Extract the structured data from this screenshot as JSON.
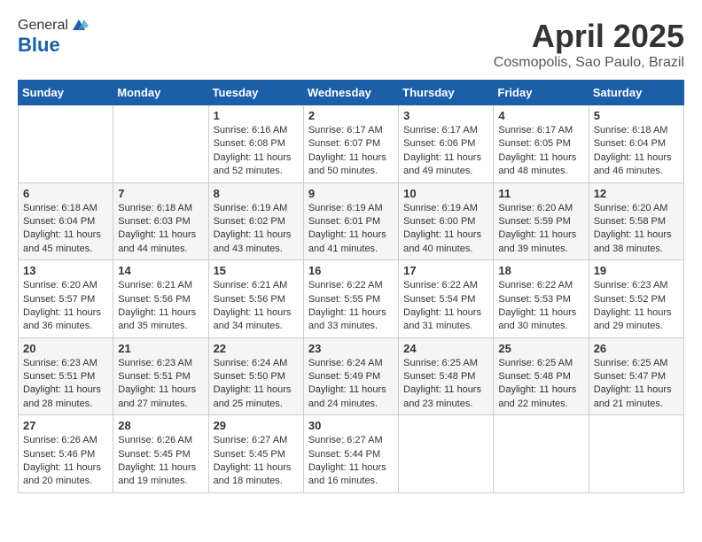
{
  "header": {
    "logo_general": "General",
    "logo_blue": "Blue",
    "month_title": "April 2025",
    "location": "Cosmopolis, Sao Paulo, Brazil"
  },
  "weekdays": [
    "Sunday",
    "Monday",
    "Tuesday",
    "Wednesday",
    "Thursday",
    "Friday",
    "Saturday"
  ],
  "weeks": [
    [
      {
        "day": "",
        "content": ""
      },
      {
        "day": "",
        "content": ""
      },
      {
        "day": "1",
        "content": "Sunrise: 6:16 AM\nSunset: 6:08 PM\nDaylight: 11 hours and 52 minutes."
      },
      {
        "day": "2",
        "content": "Sunrise: 6:17 AM\nSunset: 6:07 PM\nDaylight: 11 hours and 50 minutes."
      },
      {
        "day": "3",
        "content": "Sunrise: 6:17 AM\nSunset: 6:06 PM\nDaylight: 11 hours and 49 minutes."
      },
      {
        "day": "4",
        "content": "Sunrise: 6:17 AM\nSunset: 6:05 PM\nDaylight: 11 hours and 48 minutes."
      },
      {
        "day": "5",
        "content": "Sunrise: 6:18 AM\nSunset: 6:04 PM\nDaylight: 11 hours and 46 minutes."
      }
    ],
    [
      {
        "day": "6",
        "content": "Sunrise: 6:18 AM\nSunset: 6:04 PM\nDaylight: 11 hours and 45 minutes."
      },
      {
        "day": "7",
        "content": "Sunrise: 6:18 AM\nSunset: 6:03 PM\nDaylight: 11 hours and 44 minutes."
      },
      {
        "day": "8",
        "content": "Sunrise: 6:19 AM\nSunset: 6:02 PM\nDaylight: 11 hours and 43 minutes."
      },
      {
        "day": "9",
        "content": "Sunrise: 6:19 AM\nSunset: 6:01 PM\nDaylight: 11 hours and 41 minutes."
      },
      {
        "day": "10",
        "content": "Sunrise: 6:19 AM\nSunset: 6:00 PM\nDaylight: 11 hours and 40 minutes."
      },
      {
        "day": "11",
        "content": "Sunrise: 6:20 AM\nSunset: 5:59 PM\nDaylight: 11 hours and 39 minutes."
      },
      {
        "day": "12",
        "content": "Sunrise: 6:20 AM\nSunset: 5:58 PM\nDaylight: 11 hours and 38 minutes."
      }
    ],
    [
      {
        "day": "13",
        "content": "Sunrise: 6:20 AM\nSunset: 5:57 PM\nDaylight: 11 hours and 36 minutes."
      },
      {
        "day": "14",
        "content": "Sunrise: 6:21 AM\nSunset: 5:56 PM\nDaylight: 11 hours and 35 minutes."
      },
      {
        "day": "15",
        "content": "Sunrise: 6:21 AM\nSunset: 5:56 PM\nDaylight: 11 hours and 34 minutes."
      },
      {
        "day": "16",
        "content": "Sunrise: 6:22 AM\nSunset: 5:55 PM\nDaylight: 11 hours and 33 minutes."
      },
      {
        "day": "17",
        "content": "Sunrise: 6:22 AM\nSunset: 5:54 PM\nDaylight: 11 hours and 31 minutes."
      },
      {
        "day": "18",
        "content": "Sunrise: 6:22 AM\nSunset: 5:53 PM\nDaylight: 11 hours and 30 minutes."
      },
      {
        "day": "19",
        "content": "Sunrise: 6:23 AM\nSunset: 5:52 PM\nDaylight: 11 hours and 29 minutes."
      }
    ],
    [
      {
        "day": "20",
        "content": "Sunrise: 6:23 AM\nSunset: 5:51 PM\nDaylight: 11 hours and 28 minutes."
      },
      {
        "day": "21",
        "content": "Sunrise: 6:23 AM\nSunset: 5:51 PM\nDaylight: 11 hours and 27 minutes."
      },
      {
        "day": "22",
        "content": "Sunrise: 6:24 AM\nSunset: 5:50 PM\nDaylight: 11 hours and 25 minutes."
      },
      {
        "day": "23",
        "content": "Sunrise: 6:24 AM\nSunset: 5:49 PM\nDaylight: 11 hours and 24 minutes."
      },
      {
        "day": "24",
        "content": "Sunrise: 6:25 AM\nSunset: 5:48 PM\nDaylight: 11 hours and 23 minutes."
      },
      {
        "day": "25",
        "content": "Sunrise: 6:25 AM\nSunset: 5:48 PM\nDaylight: 11 hours and 22 minutes."
      },
      {
        "day": "26",
        "content": "Sunrise: 6:25 AM\nSunset: 5:47 PM\nDaylight: 11 hours and 21 minutes."
      }
    ],
    [
      {
        "day": "27",
        "content": "Sunrise: 6:26 AM\nSunset: 5:46 PM\nDaylight: 11 hours and 20 minutes."
      },
      {
        "day": "28",
        "content": "Sunrise: 6:26 AM\nSunset: 5:45 PM\nDaylight: 11 hours and 19 minutes."
      },
      {
        "day": "29",
        "content": "Sunrise: 6:27 AM\nSunset: 5:45 PM\nDaylight: 11 hours and 18 minutes."
      },
      {
        "day": "30",
        "content": "Sunrise: 6:27 AM\nSunset: 5:44 PM\nDaylight: 11 hours and 16 minutes."
      },
      {
        "day": "",
        "content": ""
      },
      {
        "day": "",
        "content": ""
      },
      {
        "day": "",
        "content": ""
      }
    ]
  ]
}
